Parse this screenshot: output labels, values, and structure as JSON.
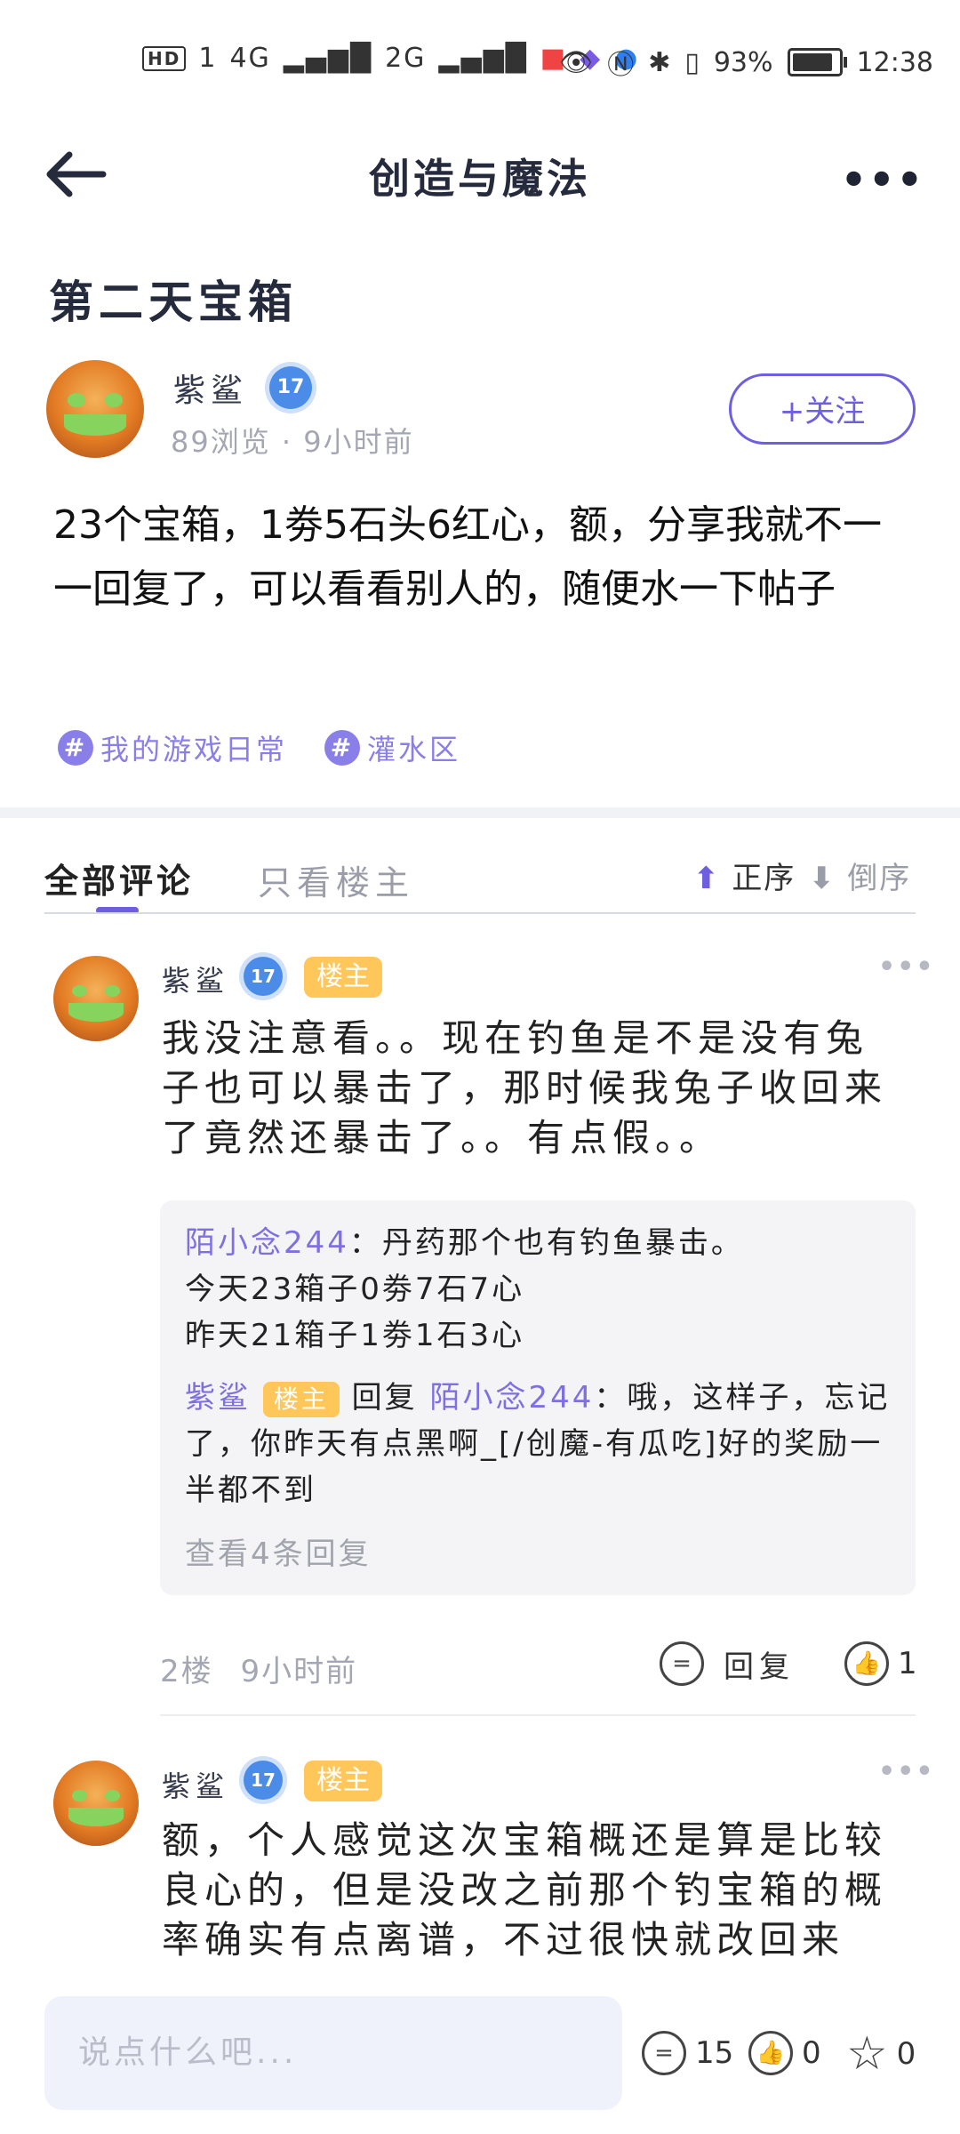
{
  "status_bar": {
    "left": [
      "HD",
      "1",
      "4G",
      "2G"
    ],
    "battery": "93%",
    "time": "12:38"
  },
  "header": {
    "title": "创造与魔法"
  },
  "post": {
    "title": "第二天宝箱",
    "author": {
      "name": "紫鲨",
      "level": "17"
    },
    "views": "89浏览",
    "time": "9小时前",
    "follow_label": "+关注",
    "content": "23个宝箱，1劵5石头6红心，额，分享我就不一一回复了，可以看看别人的，随便水一下帖子",
    "tags": [
      "我的游戏日常",
      "灌水区"
    ]
  },
  "comments_tabs": {
    "all": "全部评论",
    "op_only": "只看楼主",
    "asc": "正序",
    "desc": "倒序"
  },
  "comments": [
    {
      "author": "紫鲨",
      "level": "17",
      "badge": "楼主",
      "text": "我没注意看。。现在钓鱼是不是没有兔子也可以暴击了，那时候我兔子收回来了竟然还暴击了。。有点假。。",
      "replies": [
        {
          "user": "陌小念244",
          "sep": "：",
          "text": "丹药那个也有钓鱼暴击。",
          "line2": "今天23箱子0劵7石7心",
          "line3": "昨天21箱子1劵1石3心"
        },
        {
          "user": "紫鲨",
          "badge": "楼主",
          "action": "回复",
          "target": "陌小念244",
          "sep": "：",
          "text": "哦，这样子，忘记了，你昨天有点黑啊_[/创魔-有瓜吃]好的奖励一半都不到"
        }
      ],
      "view_more": "查看4条回复",
      "floor": "2楼",
      "time": "9小时前",
      "reply_label": "回复",
      "likes": "1"
    },
    {
      "author": "紫鲨",
      "level": "17",
      "badge": "楼主",
      "text": "额，个人感觉这次宝箱概还是算是比较良心的，但是没改之前那个钓宝箱的概率确实有点离谱，不过很快就改回来"
    }
  ],
  "bottom_bar": {
    "placeholder": "说点什么吧...",
    "comments": "15",
    "likes": "0",
    "stars": "0"
  }
}
